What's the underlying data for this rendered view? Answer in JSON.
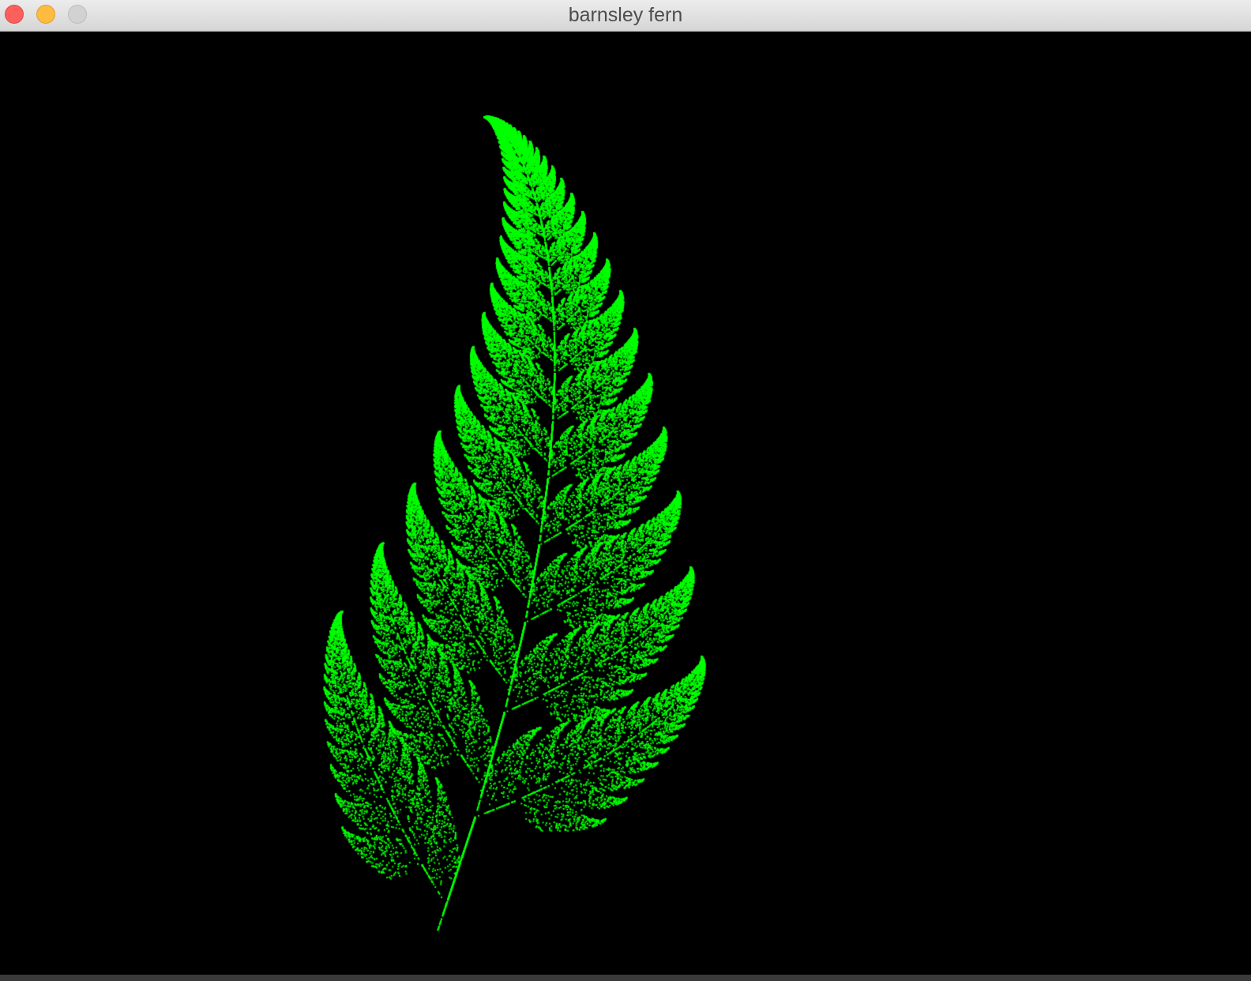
{
  "window": {
    "title": "barnsley fern"
  },
  "fern": {
    "color": "#00ff00",
    "background": "#000000"
  }
}
